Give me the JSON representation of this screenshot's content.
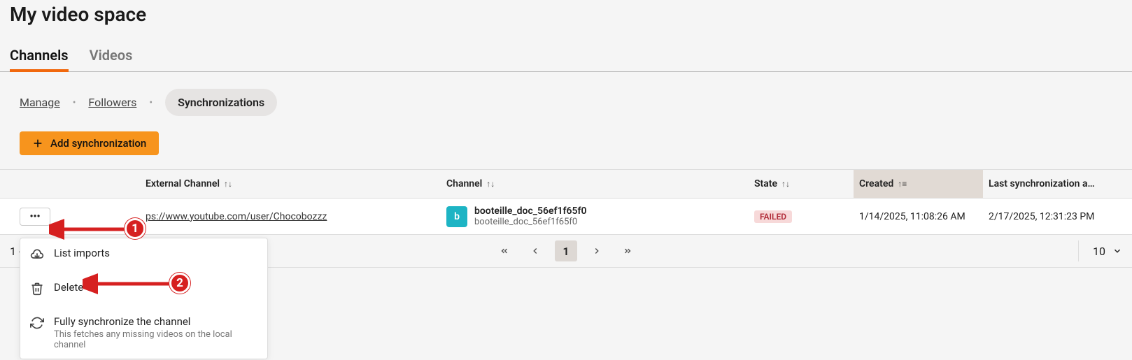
{
  "page_title": "My video space",
  "primary_tabs": {
    "channels": "Channels",
    "videos": "Videos",
    "active": "channels"
  },
  "sub_nav": {
    "manage": "Manage",
    "followers": "Followers",
    "synchronizations": "Synchronizations",
    "active": "synchronizations"
  },
  "add_button_label": "Add synchronization",
  "columns": {
    "external_channel": "External Channel",
    "channel": "Channel",
    "state": "State",
    "created": "Created",
    "last_sync": "Last synchronization a…"
  },
  "row": {
    "external_url_display": "ps://www.youtube.com/user/Chocobozzz",
    "channel_avatar_letter": "b",
    "channel_name": "booteille_doc_56ef1f65f0",
    "channel_handle": "booteille_doc_56ef1f65f0",
    "state_label": "FAILED",
    "created_at": "1/14/2025, 11:08:26 AM",
    "last_sync_at": "2/17/2025, 12:31:23 PM"
  },
  "footer": {
    "range_label": "1 -",
    "current_page": "1",
    "page_size": "10"
  },
  "dropdown": {
    "list_imports": "List imports",
    "delete": "Delete",
    "full_sync": "Fully synchronize the channel",
    "full_sync_desc": "This fetches any missing videos on the local channel"
  },
  "callouts": {
    "one": "1",
    "two": "2"
  }
}
